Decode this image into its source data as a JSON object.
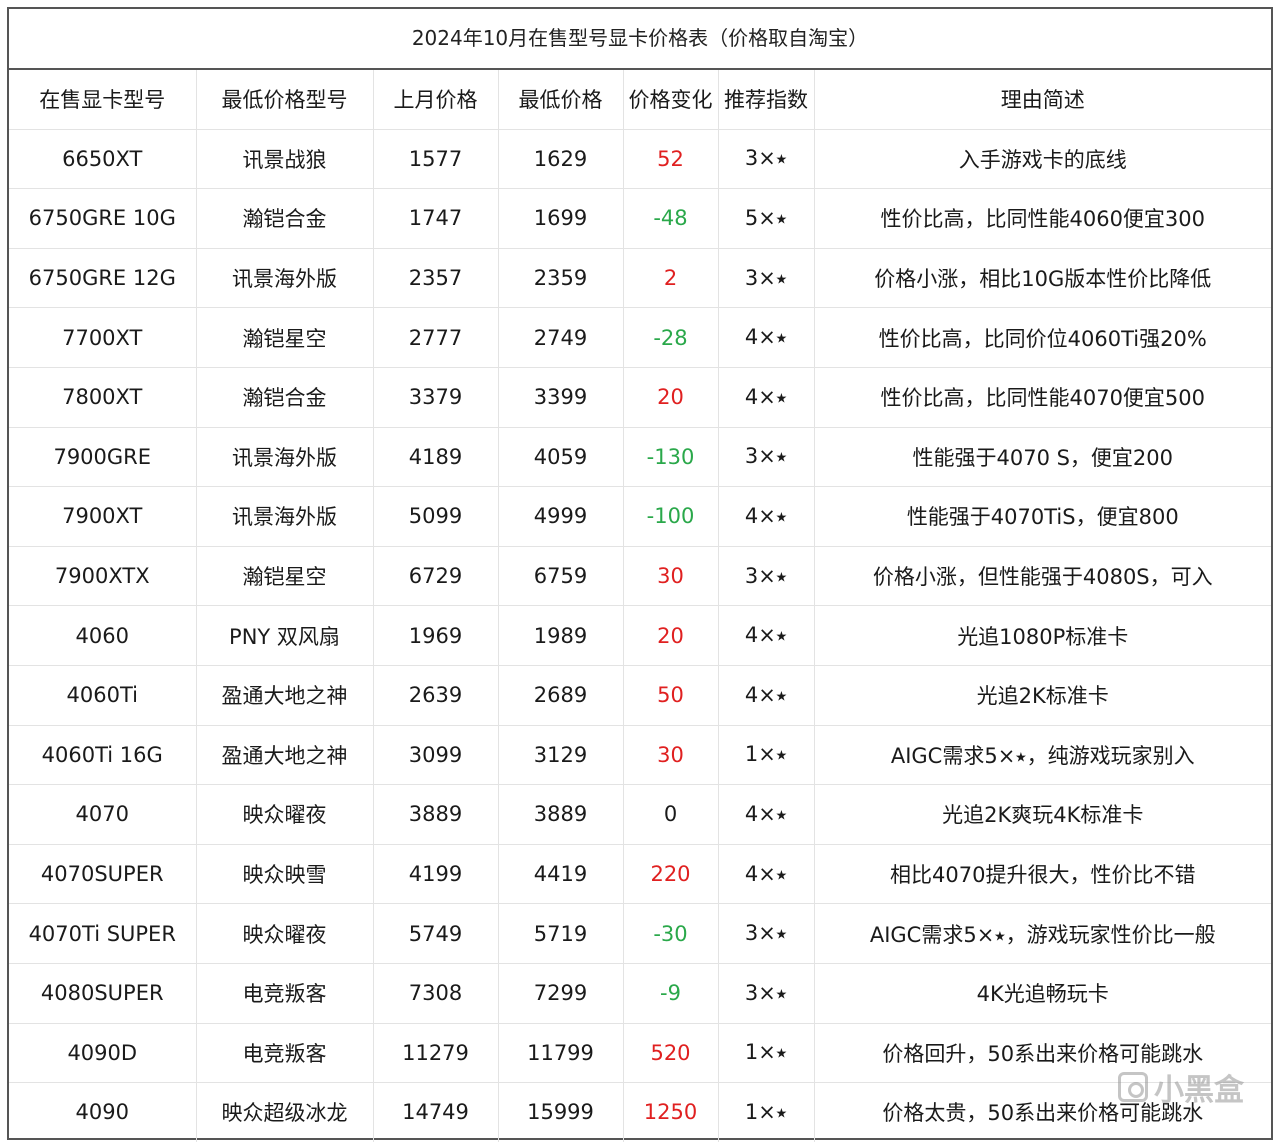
{
  "title": "2024年10月在售型号显卡价格表（价格取自淘宝）",
  "headers": [
    "在售显卡型号",
    "最低价格型号",
    "上月价格",
    "最低价格",
    "价格变化",
    "推荐指数",
    "理由简述"
  ],
  "rows": [
    {
      "model": "6650XT",
      "brand": "讯景战狼",
      "last_month": "1577",
      "lowest": "1629",
      "change": "52",
      "rating": "3×⭑",
      "reason": "入手游戏卡的底线"
    },
    {
      "model": "6750GRE 10G",
      "brand": "瀚铠合金",
      "last_month": "1747",
      "lowest": "1699",
      "change": "-48",
      "rating": "5×⭑",
      "reason": "性价比高，比同性能4060便宜300"
    },
    {
      "model": "6750GRE 12G",
      "brand": "讯景海外版",
      "last_month": "2357",
      "lowest": "2359",
      "change": "2",
      "rating": "3×⭑",
      "reason": "价格小涨，相比10G版本性价比降低"
    },
    {
      "model": "7700XT",
      "brand": "瀚铠星空",
      "last_month": "2777",
      "lowest": "2749",
      "change": "-28",
      "rating": "4×⭑",
      "reason": "性价比高，比同价位4060Ti强20%"
    },
    {
      "model": "7800XT",
      "brand": "瀚铠合金",
      "last_month": "3379",
      "lowest": "3399",
      "change": "20",
      "rating": "4×⭑",
      "reason": "性价比高，比同性能4070便宜500"
    },
    {
      "model": "7900GRE",
      "brand": "讯景海外版",
      "last_month": "4189",
      "lowest": "4059",
      "change": "-130",
      "rating": "3×⭑",
      "reason": "性能强于4070 S，便宜200"
    },
    {
      "model": "7900XT",
      "brand": "讯景海外版",
      "last_month": "5099",
      "lowest": "4999",
      "change": "-100",
      "rating": "4×⭑",
      "reason": "性能强于4070TiS，便宜800"
    },
    {
      "model": "7900XTX",
      "brand": "瀚铠星空",
      "last_month": "6729",
      "lowest": "6759",
      "change": "30",
      "rating": "3×⭑",
      "reason": "价格小涨，但性能强于4080S，可入"
    },
    {
      "model": "4060",
      "brand": "PNY 双风扇",
      "last_month": "1969",
      "lowest": "1989",
      "change": "20",
      "rating": "4×⭑",
      "reason": "光追1080P标准卡"
    },
    {
      "model": "4060Ti",
      "brand": "盈通大地之神",
      "last_month": "2639",
      "lowest": "2689",
      "change": "50",
      "rating": "4×⭑",
      "reason": "光追2K标准卡"
    },
    {
      "model": "4060Ti 16G",
      "brand": "盈通大地之神",
      "last_month": "3099",
      "lowest": "3129",
      "change": "30",
      "rating": "1×⭑",
      "reason": "AIGC需求5×⭑，纯游戏玩家别入"
    },
    {
      "model": "4070",
      "brand": "映众曜夜",
      "last_month": "3889",
      "lowest": "3889",
      "change": "0",
      "rating": "4×⭑",
      "reason": "光追2K爽玩4K标准卡"
    },
    {
      "model": "4070SUPER",
      "brand": "映众映雪",
      "last_month": "4199",
      "lowest": "4419",
      "change": "220",
      "rating": "4×⭑",
      "reason": "相比4070提升很大，性价比不错"
    },
    {
      "model": "4070Ti SUPER",
      "brand": "映众曜夜",
      "last_month": "5749",
      "lowest": "5719",
      "change": "-30",
      "rating": "3×⭑",
      "reason": "AIGC需求5×⭑，游戏玩家性价比一般"
    },
    {
      "model": "4080SUPER",
      "brand": "电竞叛客",
      "last_month": "7308",
      "lowest": "7299",
      "change": "-9",
      "rating": "3×⭑",
      "reason": "4K光追畅玩卡"
    },
    {
      "model": "4090D",
      "brand": "电竞叛客",
      "last_month": "11279",
      "lowest": "11799",
      "change": "520",
      "rating": "1×⭑",
      "reason": "价格回升，50系出来价格可能跳水"
    },
    {
      "model": "4090",
      "brand": "映众超级冰龙",
      "last_month": "14749",
      "lowest": "15999",
      "change": "1250",
      "rating": "1×⭑",
      "reason": "价格太贵，50系出来价格可能跳水"
    }
  ],
  "colors": {
    "increase": "#e02020",
    "decrease": "#2aa84a",
    "neutral": "#1a1a1a"
  },
  "watermark": {
    "text": "小黑盒",
    "icon": "heybox-logo-icon"
  }
}
